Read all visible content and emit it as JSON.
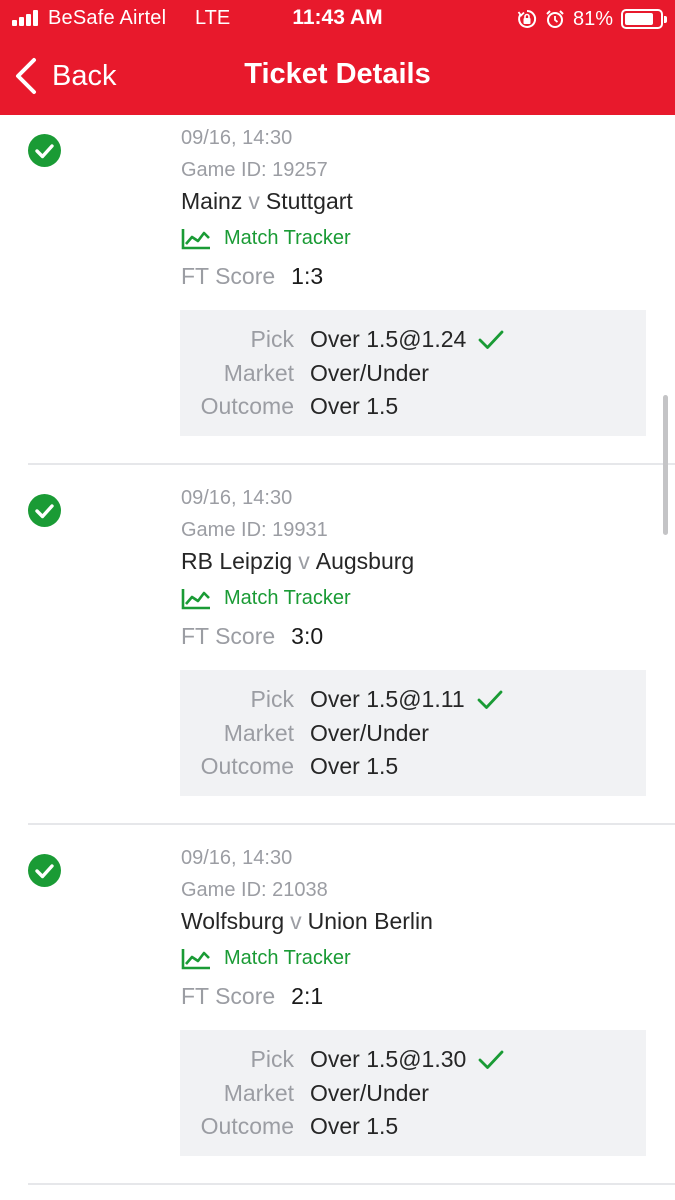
{
  "status_bar": {
    "carrier": "BeSafe Airtel",
    "network": "LTE",
    "time": "11:43 AM",
    "battery_percent": "81%",
    "battery_level": 0.81,
    "icons": [
      "signal-bars-icon",
      "orientation-lock-icon",
      "alarm-icon",
      "battery-icon"
    ]
  },
  "nav": {
    "back_label": "Back",
    "title": "Ticket Details"
  },
  "colors": {
    "header_bg": "#e8192c",
    "win_green": "#1a9b35",
    "muted_text": "#9b9da3",
    "pick_box_bg": "#f1f2f4"
  },
  "labels": {
    "match_tracker": "Match Tracker",
    "ft_score": "FT Score",
    "pick": "Pick",
    "market": "Market",
    "outcome": "Outcome",
    "vs": "v"
  },
  "tickets": [
    {
      "datetime": "09/16, 14:30",
      "game_id": "Game ID: 19257",
      "home": "Mainz",
      "away": "Stuttgart",
      "ft_score": "1:3",
      "pick": "Over 1.5@1.24",
      "market": "Over/Under",
      "outcome": "Over 1.5",
      "status": "won"
    },
    {
      "datetime": "09/16, 14:30",
      "game_id": "Game ID: 19931",
      "home": "RB Leipzig",
      "away": "Augsburg",
      "ft_score": "3:0",
      "pick": "Over 1.5@1.11",
      "market": "Over/Under",
      "outcome": "Over 1.5",
      "status": "won"
    },
    {
      "datetime": "09/16, 14:30",
      "game_id": "Game ID: 21038",
      "home": "Wolfsburg",
      "away": "Union Berlin",
      "ft_score": "2:1",
      "pick": "Over 1.5@1.30",
      "market": "Over/Under",
      "outcome": "Over 1.5",
      "status": "won"
    }
  ]
}
